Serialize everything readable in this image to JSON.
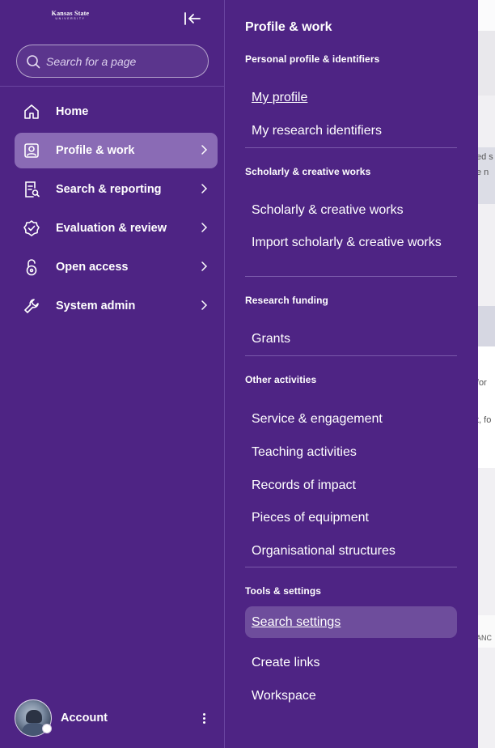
{
  "sidebar": {
    "logo_line1": "Kansas State",
    "logo_line2": "UNIVERSITY",
    "search_placeholder": "Search for a page",
    "nav": [
      {
        "label": "Home",
        "icon": "home-icon"
      },
      {
        "label": "Profile & work",
        "icon": "profile-icon",
        "active": true
      },
      {
        "label": "Search & reporting",
        "icon": "report-search-icon"
      },
      {
        "label": "Evaluation & review",
        "icon": "check-badge-icon"
      },
      {
        "label": "Open access",
        "icon": "open-lock-icon"
      },
      {
        "label": "System admin",
        "icon": "wrench-icon"
      }
    ],
    "account_label": "Account"
  },
  "panel": {
    "title": "Profile & work",
    "sections": [
      {
        "heading": "Personal profile & identifiers",
        "items": [
          "My profile",
          "My research identifiers"
        ]
      },
      {
        "heading": "Scholarly & creative works",
        "items": [
          "Scholarly & creative works",
          "Import scholarly & creative works"
        ]
      },
      {
        "heading": "Research funding",
        "items": [
          "Grants"
        ]
      },
      {
        "heading": "Other activities",
        "items": [
          "Service & engagement",
          "Teaching activities",
          "Records of impact",
          "Pieces of equipment",
          "Organisational structures"
        ]
      },
      {
        "heading": "Tools & settings",
        "items": [
          "Search settings",
          "Create links",
          "Workspace"
        ]
      }
    ]
  },
  "background_page": {
    "fragments": [
      "ed s",
      "e n",
      "for",
      "t, fo",
      "ANC"
    ]
  },
  "colors": {
    "sidebar_bg": "#4e2484",
    "active_item_bg": "#8a6bb5",
    "highlight_item_bg": "#6e4d9c",
    "text": "#ffffff"
  }
}
